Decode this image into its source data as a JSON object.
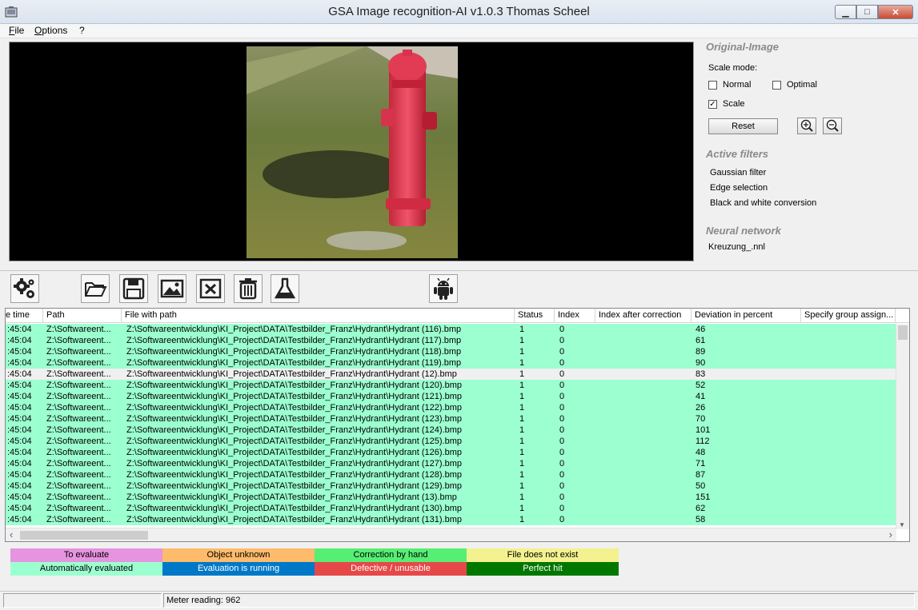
{
  "window": {
    "title": "GSA Image recognition-AI v1.0.3  Thomas Scheel",
    "minimize_glyph": "▁",
    "maximize_glyph": "□",
    "close_glyph": "✕"
  },
  "menu": {
    "items": [
      "File",
      "Options",
      "?"
    ]
  },
  "panel": {
    "original_image_title": "Original-Image",
    "scale_mode_label": "Scale mode:",
    "normal_label": "Normal",
    "normal_checked": false,
    "optimal_label": "Optimal",
    "optimal_checked": false,
    "scale_label": "Scale",
    "scale_checked": true,
    "check_glyph": "✓",
    "reset_label": "Reset",
    "active_filters_title": "Active filters",
    "filters": [
      "Gaussian filter",
      "Edge selection",
      "Black and white conversion"
    ],
    "neural_network_title": "Neural network",
    "network_file": "Kreuzung_.nnl"
  },
  "toolbar": {
    "icons": [
      "settings-gears-icon",
      "open-folder-icon",
      "save-icon",
      "image-icon",
      "close-x-icon",
      "trash-icon",
      "flask-icon",
      "android-icon"
    ]
  },
  "table": {
    "columns": [
      "e time",
      "Path",
      "File with path",
      "Status",
      "Index",
      "Index after correction",
      "Deviation in percent",
      "Specify group assign..."
    ],
    "rows": [
      {
        "time": ":45:04",
        "path": "Z:\\Softwareent...",
        "file": "Z:\\Softwareentwicklung\\KI_Project\\DATA\\Testbilder_Franz\\Hydrant\\Hydrant (116).bmp",
        "status": "1",
        "index": "0",
        "index_after": "",
        "deviation": "46",
        "group": "",
        "selected": false
      },
      {
        "time": ":45:04",
        "path": "Z:\\Softwareent...",
        "file": "Z:\\Softwareentwicklung\\KI_Project\\DATA\\Testbilder_Franz\\Hydrant\\Hydrant (117).bmp",
        "status": "1",
        "index": "0",
        "index_after": "",
        "deviation": "61",
        "group": "",
        "selected": false
      },
      {
        "time": ":45:04",
        "path": "Z:\\Softwareent...",
        "file": "Z:\\Softwareentwicklung\\KI_Project\\DATA\\Testbilder_Franz\\Hydrant\\Hydrant (118).bmp",
        "status": "1",
        "index": "0",
        "index_after": "",
        "deviation": "89",
        "group": "",
        "selected": false
      },
      {
        "time": ":45:04",
        "path": "Z:\\Softwareent...",
        "file": "Z:\\Softwareentwicklung\\KI_Project\\DATA\\Testbilder_Franz\\Hydrant\\Hydrant (119).bmp",
        "status": "1",
        "index": "0",
        "index_after": "",
        "deviation": "90",
        "group": "",
        "selected": false
      },
      {
        "time": ":45:04",
        "path": "Z:\\Softwareent...",
        "file": "Z:\\Softwareentwicklung\\KI_Project\\DATA\\Testbilder_Franz\\Hydrant\\Hydrant (12).bmp",
        "status": "1",
        "index": "0",
        "index_after": "",
        "deviation": "83",
        "group": "",
        "selected": true
      },
      {
        "time": ":45:04",
        "path": "Z:\\Softwareent...",
        "file": "Z:\\Softwareentwicklung\\KI_Project\\DATA\\Testbilder_Franz\\Hydrant\\Hydrant (120).bmp",
        "status": "1",
        "index": "0",
        "index_after": "",
        "deviation": "52",
        "group": "",
        "selected": false
      },
      {
        "time": ":45:04",
        "path": "Z:\\Softwareent...",
        "file": "Z:\\Softwareentwicklung\\KI_Project\\DATA\\Testbilder_Franz\\Hydrant\\Hydrant (121).bmp",
        "status": "1",
        "index": "0",
        "index_after": "",
        "deviation": "41",
        "group": "",
        "selected": false
      },
      {
        "time": ":45:04",
        "path": "Z:\\Softwareent...",
        "file": "Z:\\Softwareentwicklung\\KI_Project\\DATA\\Testbilder_Franz\\Hydrant\\Hydrant (122).bmp",
        "status": "1",
        "index": "0",
        "index_after": "",
        "deviation": "26",
        "group": "",
        "selected": false
      },
      {
        "time": ":45:04",
        "path": "Z:\\Softwareent...",
        "file": "Z:\\Softwareentwicklung\\KI_Project\\DATA\\Testbilder_Franz\\Hydrant\\Hydrant (123).bmp",
        "status": "1",
        "index": "0",
        "index_after": "",
        "deviation": "70",
        "group": "",
        "selected": false
      },
      {
        "time": ":45:04",
        "path": "Z:\\Softwareent...",
        "file": "Z:\\Softwareentwicklung\\KI_Project\\DATA\\Testbilder_Franz\\Hydrant\\Hydrant (124).bmp",
        "status": "1",
        "index": "0",
        "index_after": "",
        "deviation": "101",
        "group": "",
        "selected": false
      },
      {
        "time": ":45:04",
        "path": "Z:\\Softwareent...",
        "file": "Z:\\Softwareentwicklung\\KI_Project\\DATA\\Testbilder_Franz\\Hydrant\\Hydrant (125).bmp",
        "status": "1",
        "index": "0",
        "index_after": "",
        "deviation": "112",
        "group": "",
        "selected": false
      },
      {
        "time": ":45:04",
        "path": "Z:\\Softwareent...",
        "file": "Z:\\Softwareentwicklung\\KI_Project\\DATA\\Testbilder_Franz\\Hydrant\\Hydrant (126).bmp",
        "status": "1",
        "index": "0",
        "index_after": "",
        "deviation": "48",
        "group": "",
        "selected": false
      },
      {
        "time": ":45:04",
        "path": "Z:\\Softwareent...",
        "file": "Z:\\Softwareentwicklung\\KI_Project\\DATA\\Testbilder_Franz\\Hydrant\\Hydrant (127).bmp",
        "status": "1",
        "index": "0",
        "index_after": "",
        "deviation": "71",
        "group": "",
        "selected": false
      },
      {
        "time": ":45:04",
        "path": "Z:\\Softwareent...",
        "file": "Z:\\Softwareentwicklung\\KI_Project\\DATA\\Testbilder_Franz\\Hydrant\\Hydrant (128).bmp",
        "status": "1",
        "index": "0",
        "index_after": "",
        "deviation": "87",
        "group": "",
        "selected": false
      },
      {
        "time": ":45:04",
        "path": "Z:\\Softwareent...",
        "file": "Z:\\Softwareentwicklung\\KI_Project\\DATA\\Testbilder_Franz\\Hydrant\\Hydrant (129).bmp",
        "status": "1",
        "index": "0",
        "index_after": "",
        "deviation": "50",
        "group": "",
        "selected": false
      },
      {
        "time": ":45:04",
        "path": "Z:\\Softwareent...",
        "file": "Z:\\Softwareentwicklung\\KI_Project\\DATA\\Testbilder_Franz\\Hydrant\\Hydrant (13).bmp",
        "status": "1",
        "index": "0",
        "index_after": "",
        "deviation": "151",
        "group": "",
        "selected": false
      },
      {
        "time": ":45:04",
        "path": "Z:\\Softwareent...",
        "file": "Z:\\Softwareentwicklung\\KI_Project\\DATA\\Testbilder_Franz\\Hydrant\\Hydrant (130).bmp",
        "status": "1",
        "index": "0",
        "index_after": "",
        "deviation": "62",
        "group": "",
        "selected": false
      },
      {
        "time": ":45:04",
        "path": "Z:\\Softwareent...",
        "file": "Z:\\Softwareentwicklung\\KI_Project\\DATA\\Testbilder_Franz\\Hydrant\\Hydrant (131).bmp",
        "status": "1",
        "index": "0",
        "index_after": "",
        "deviation": "58",
        "group": "",
        "selected": false
      }
    ],
    "row_color": "#9cffd0",
    "selected_row_color": "#f0f0f0",
    "scroll_left_glyph": "‹",
    "scroll_right_glyph": "›",
    "scroll_up_glyph": "▲",
    "scroll_down_glyph": "▼"
  },
  "legend": [
    {
      "label": "To evaluate",
      "bg": "#e693e0",
      "fg": "#000000"
    },
    {
      "label": "Object unknown",
      "bg": "#fdbb6b",
      "fg": "#000000"
    },
    {
      "label": "Correction by hand",
      "bg": "#56ef74",
      "fg": "#000000"
    },
    {
      "label": "File does not exist",
      "bg": "#f3f28e",
      "fg": "#000000"
    },
    {
      "label": "Automatically evaluated",
      "bg": "#9cffd0",
      "fg": "#000000"
    },
    {
      "label": "Evaluation is running",
      "bg": "#0078c8",
      "fg": "#ffffff"
    },
    {
      "label": "Defective / unusable",
      "bg": "#e64848",
      "fg": "#ffffff"
    },
    {
      "label": "Perfect hit",
      "bg": "#007800",
      "fg": "#ffffff"
    }
  ],
  "status_bar": {
    "left": "",
    "meter": "Meter reading: 962"
  }
}
